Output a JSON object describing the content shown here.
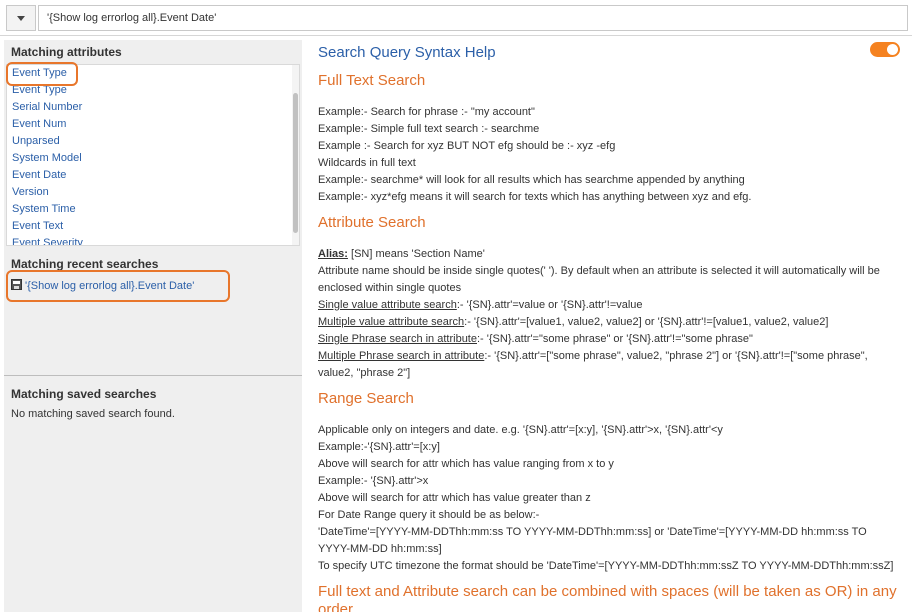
{
  "search": {
    "query": "'{Show log errorlog all}.Event Date'"
  },
  "attributes": {
    "title": "Matching attributes",
    "items": [
      "Event Type",
      "Event Type",
      "Serial Number",
      "Event Num",
      "Unparsed",
      "System Model",
      "Event Date",
      "Version",
      "System Time",
      "Event Text",
      "Event Severity"
    ]
  },
  "recent": {
    "title": "Matching recent searches",
    "item": "'{Show log errorlog all}.Event Date'"
  },
  "saved": {
    "title": "Matching saved searches",
    "empty": "No matching saved search found."
  },
  "help": {
    "title": "Search Query Syntax Help",
    "full_text": {
      "heading": "Full Text Search",
      "lines": [
        "Example:- Search for phrase :- \"my account\"",
        "Example:- Simple full text search :- searchme",
        "Example :- Search for xyz BUT NOT efg should be :- xyz -efg",
        "Wildcards in full text",
        "Example:- searchme* will look for all results which has searchme appended by anything",
        "Example:- xyz*efg means it will search for texts which has anything between xyz and efg."
      ]
    },
    "attribute": {
      "heading": "Attribute Search",
      "alias_label": "Alias:",
      "alias_text": " [SN] means 'Section Name'",
      "quotes_text": "Attribute name should be inside single quotes(' '). By default when an attribute is selected it will automatically will be enclosed within single quotes",
      "single_value_label": "Single value attribute search",
      "single_value_text": ":- '{SN}.attr'=value or '{SN}.attr'!=value",
      "multi_value_label": "Multiple value attribute search",
      "multi_value_text": ":- '{SN}.attr'=[value1, value2, value2] or '{SN}.attr'!=[value1, value2, value2]",
      "single_phrase_label": "Single Phrase search in attribute",
      "single_phrase_text": ":- '{SN}.attr'=\"some phrase\" or '{SN}.attr'!=\"some phrase\"",
      "multi_phrase_label": "Multiple Phrase search in attribute",
      "multi_phrase_text": ":- '{SN}.attr'=[\"some phrase\", value2, \"phrase 2\"] or '{SN}.attr'!=[\"some phrase\", value2, \"phrase 2\"]"
    },
    "range": {
      "heading": "Range Search",
      "lines": [
        "Applicable only on integers and date. e.g. '{SN}.attr'=[x:y], '{SN}.attr'>x, '{SN}.attr'<y",
        "Example:-'{SN}.attr'=[x:y]",
        "Above will search for attr which has value ranging from x to y",
        "Example:- '{SN}.attr'>x",
        "Above will search for attr which has value greater than z",
        "For Date Range query it should be as below:-",
        "'DateTime'=[YYYY-MM-DDThh:mm:ss TO YYYY-MM-DDThh:mm:ss] or 'DateTime'=[YYYY-MM-DD hh:mm:ss TO YYYY-MM-DD hh:mm:ss]",
        "To specify UTC timezone the format should be 'DateTime'=[YYYY-MM-DDThh:mm:ssZ TO YYYY-MM-DDThh:mm:ssZ]"
      ]
    },
    "combined": {
      "heading": "Full text and Attribute search can be combined with spaces (will be taken as OR) in any order"
    }
  },
  "colors": {
    "accent": "#e8762b",
    "link": "#2b5fa8",
    "heading": "#e0712c"
  },
  "icons": {
    "dropdown": "chevron-down-icon",
    "recent": "save-icon",
    "toggle": "toggle-switch"
  }
}
